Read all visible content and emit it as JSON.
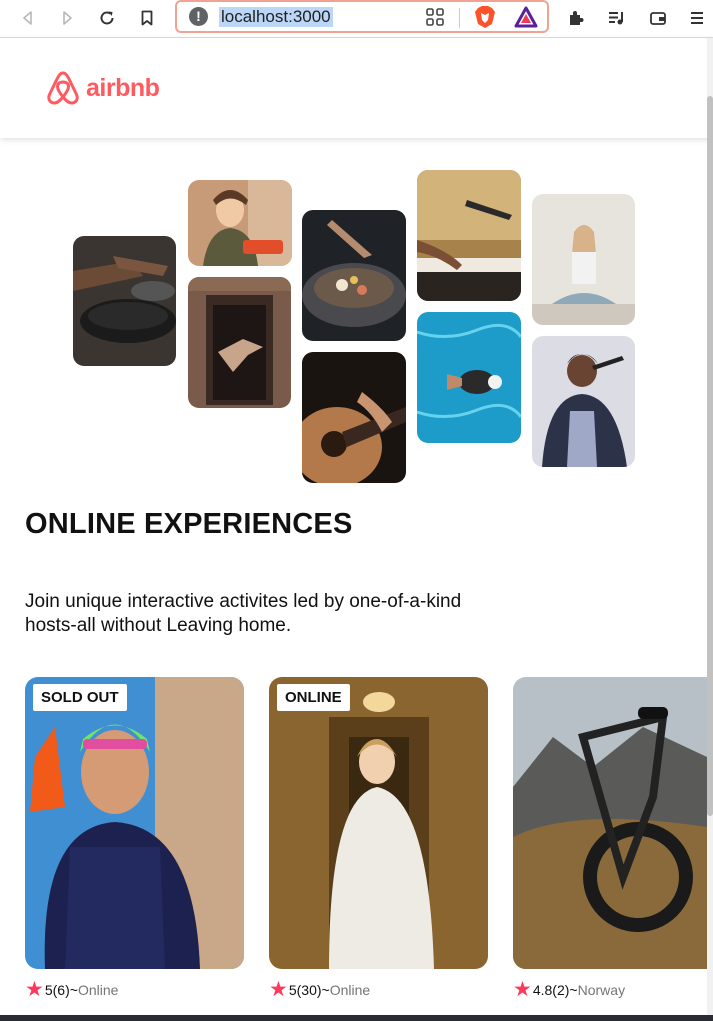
{
  "browser": {
    "url": "localhost:3000",
    "icons": [
      "back-icon",
      "forward-icon",
      "reload-icon",
      "bookmark-icon",
      "info-icon",
      "qr-icon",
      "brave-shield-icon",
      "rewards-icon",
      "extensions-icon",
      "playlist-icon",
      "wallet-icon",
      "menu-icon"
    ]
  },
  "header": {
    "logo_text": "airbnb"
  },
  "colors": {
    "brand": "#FF5A5F",
    "star": "#FF385C",
    "loc": "#757575"
  },
  "hero": {
    "title": "ONLINE EXPERIENCES",
    "text": "Join unique interactive activites led by one-of-a-kind hosts-all without Leaving home."
  },
  "photos": [
    {
      "subject": "cooking"
    },
    {
      "subject": "woman-with-sushi"
    },
    {
      "subject": "dancer-in-doorway"
    },
    {
      "subject": "food-bowl"
    },
    {
      "subject": "guitar"
    },
    {
      "subject": "keyboard-and-mic"
    },
    {
      "subject": "swimmer"
    },
    {
      "subject": "yoga"
    },
    {
      "subject": "singer"
    }
  ],
  "cards": [
    {
      "badge": "SOLD OUT",
      "rating": "5",
      "reviews": "(6)",
      "sep": " ~",
      "location": "Online",
      "subject": "triathlete"
    },
    {
      "badge": "ONLINE",
      "rating": "5",
      "reviews": "(30)",
      "sep": " ~",
      "location": "Online",
      "subject": "bride"
    },
    {
      "badge": "",
      "rating": "4.8",
      "reviews": "(2)",
      "sep": " ~",
      "location": "Norway",
      "subject": "mountain-bike"
    }
  ]
}
